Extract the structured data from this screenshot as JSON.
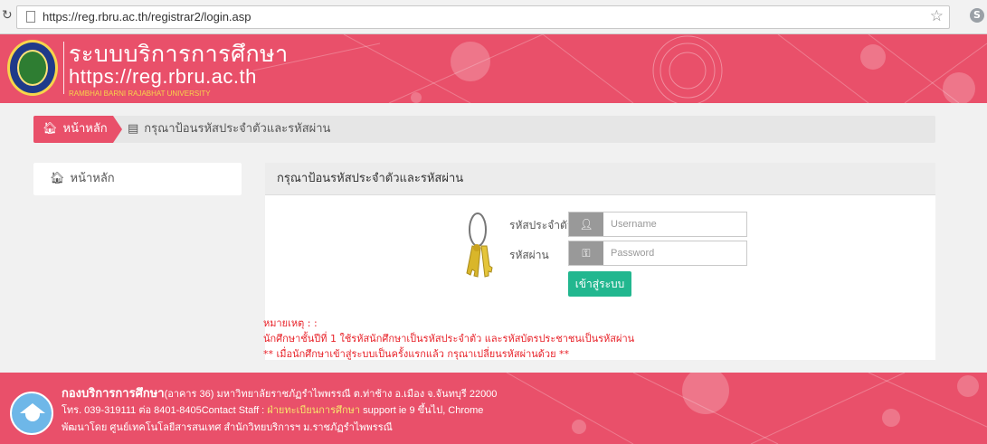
{
  "browser": {
    "url": "https://reg.rbru.ac.th/registrar2/login.asp"
  },
  "header": {
    "title": "ระบบบริการการศึกษา",
    "url_text": "https://reg.rbru.ac.th",
    "university": "RAMBHAI BARNI RAJABHAT UNIVERSITY"
  },
  "breadcrumb": {
    "home": "หน้าหลัก",
    "current": "กรุณาป้อนรหัสประจำตัวและรหัสผ่าน"
  },
  "sidebar": {
    "items": [
      {
        "label": "หน้าหลัก",
        "icon": "home-icon"
      }
    ]
  },
  "login": {
    "panel_title": "กรุณาป้อนรหัสประจำตัวและรหัสผ่าน",
    "id_label": "รหัสประจำตัว",
    "pw_label": "รหัสผ่าน",
    "username_placeholder": "Username",
    "password_placeholder": "Password",
    "submit": "เข้าสู่ระบบ"
  },
  "notes": {
    "title": "หมายเหตุ : :",
    "line1": "นักศึกษาชั้นปีที่ 1 ใช้รหัสนักศึกษาเป็นรหัสประจำตัว และรหัสบัตรประชาชนเป็นรหัสผ่าน",
    "line2": "** เมื่อนักศึกษาเข้าสู่ระบบเป็นครั้งแรกแล้ว กรุณาเปลี่ยนรหัสผ่านด้วย **"
  },
  "footer": {
    "org": "กองบริการการศึกษา",
    "address": "(อาคาร 36) มหาวิทยาลัยราชภัฏรำไพพรรณี ต.ท่าช้าง อ.เมือง จ.จันทบุรี 22000",
    "phone": "โทร. 039-319111 ต่อ 8401-8405Contact Staff : ",
    "staff_link": "ฝ่ายทะเบียนการศึกษา",
    "support": " support ie 9 ขึ้นไป, Chrome",
    "developer": "พัฒนาโดย ศูนย์เทคโนโลยีสารสนเทศ สำนักวิทยบริการฯ ม.ราชภัฏรำไพพรรณี"
  },
  "colors": {
    "brand_pink": "#e9506a",
    "button_green": "#22b78f",
    "note_red": "#e8232a",
    "footer_yellow": "#f7e36c"
  }
}
